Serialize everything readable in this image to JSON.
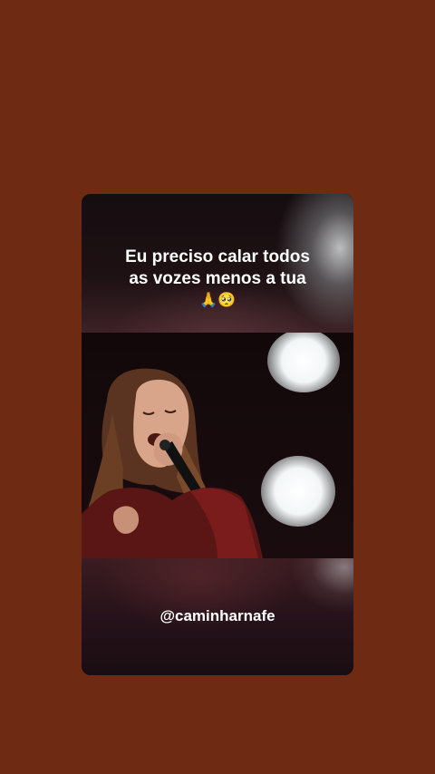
{
  "story": {
    "caption_line_1": "Eu preciso calar todos",
    "caption_line_2": "as vozes menos a tua",
    "caption_emojis": "🙏🥺",
    "handle": "@caminharnafe"
  },
  "colors": {
    "page_background": "#6e2a12",
    "caption_text": "#ffffff"
  },
  "icons": {
    "media": "singer-video-frame"
  }
}
